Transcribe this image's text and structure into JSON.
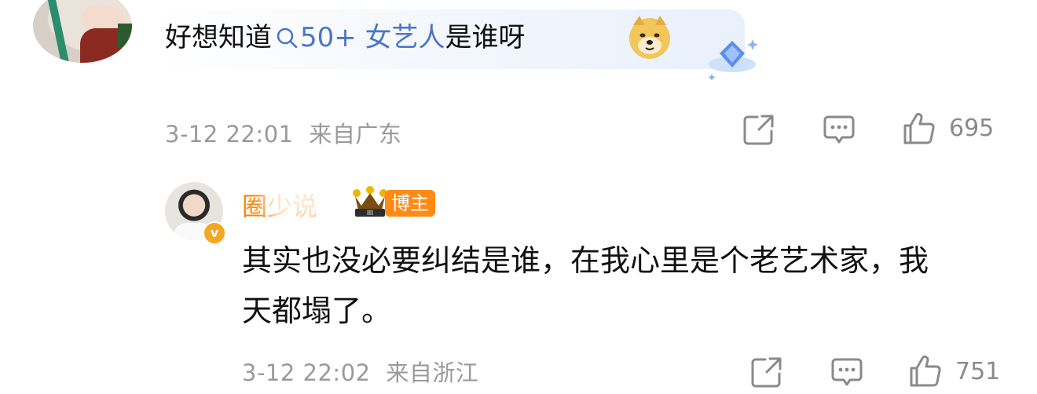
{
  "comment": {
    "text_before": "好想知道",
    "search_link": "50+ 女艺人",
    "text_after": "是谁呀",
    "date": "3-12 22:01",
    "location": "来自广东",
    "likes": "695"
  },
  "reply": {
    "username": "圈少说",
    "role_badge": "博主",
    "text": "其实也没必要纠结是谁，在我心里是个老艺术家，我天都塌了。",
    "date": "3-12 22:02",
    "location": "来自浙江",
    "likes": "751"
  },
  "icons": [
    "share-icon",
    "comment-icon",
    "like-icon",
    "search-icon",
    "doge-emoji",
    "verified-icon",
    "crown-icon",
    "gem-badge-icon"
  ],
  "colors": {
    "link": "#4a76c7",
    "username": "#ff8200",
    "badge": "#ff8a14",
    "meta": "#9a9a9a"
  }
}
